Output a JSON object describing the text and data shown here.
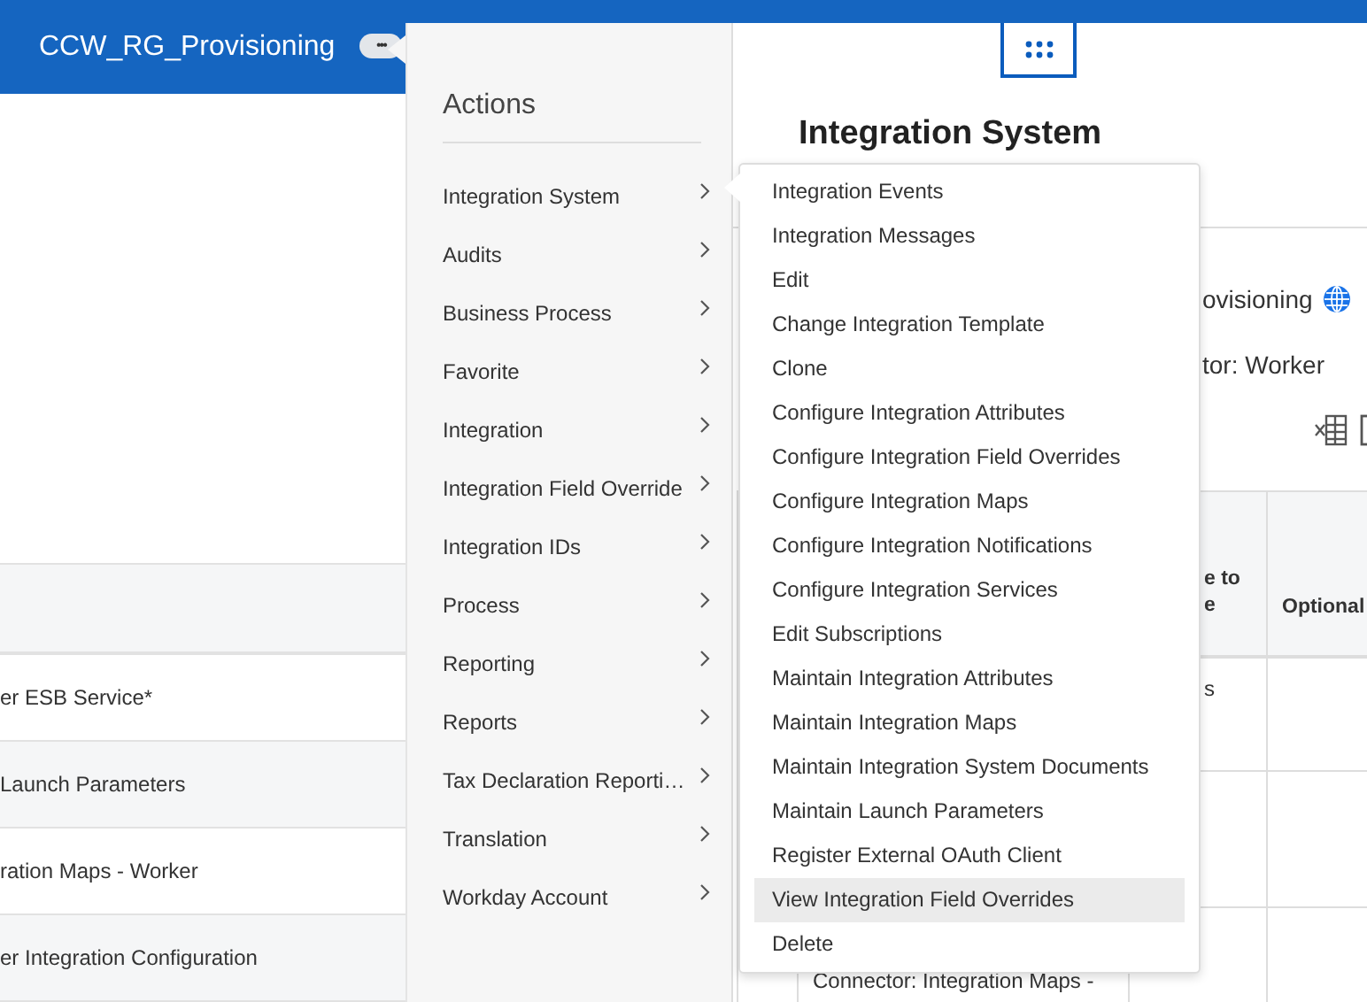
{
  "header": {
    "title": "CCW_RG_Provisioning",
    "more_button": "•••"
  },
  "background_table": {
    "rows": [
      {
        "text": "er ESB Service*"
      },
      {
        "text": "Launch Parameters"
      },
      {
        "text": "ration Maps - Worker"
      },
      {
        "text": "er Integration Configuration"
      }
    ]
  },
  "panel": {
    "title": "Integration System",
    "name_fragment": "ovisioning",
    "type_fragment": "tor: Worker",
    "table": {
      "columns": [
        "e to\ne",
        "Optional"
      ],
      "cells": [
        "s",
        "Connector: Integration Maps -"
      ]
    }
  },
  "actions_menu": {
    "title": "Actions",
    "items": [
      {
        "label": "Integration System"
      },
      {
        "label": "Audits"
      },
      {
        "label": "Business Process"
      },
      {
        "label": "Favorite"
      },
      {
        "label": "Integration"
      },
      {
        "label": "Integration Field Override"
      },
      {
        "label": "Integration IDs"
      },
      {
        "label": "Process"
      },
      {
        "label": "Reporting"
      },
      {
        "label": "Reports"
      },
      {
        "label": "Tax Declaration Reporti…"
      },
      {
        "label": "Translation"
      },
      {
        "label": "Workday Account"
      }
    ]
  },
  "submenu": {
    "items": [
      {
        "label": "Integration Events",
        "selected": false
      },
      {
        "label": "Integration Messages",
        "selected": false
      },
      {
        "label": "Edit",
        "selected": false
      },
      {
        "label": "Change Integration Template",
        "selected": false
      },
      {
        "label": "Clone",
        "selected": false
      },
      {
        "label": "Configure Integration Attributes",
        "selected": false
      },
      {
        "label": "Configure Integration Field Overrides",
        "selected": false
      },
      {
        "label": "Configure Integration Maps",
        "selected": false
      },
      {
        "label": "Configure Integration Notifications",
        "selected": false
      },
      {
        "label": "Configure Integration Services",
        "selected": false
      },
      {
        "label": "Edit Subscriptions",
        "selected": false
      },
      {
        "label": "Maintain Integration Attributes",
        "selected": false
      },
      {
        "label": "Maintain Integration Maps",
        "selected": false
      },
      {
        "label": "Maintain Integration System Documents",
        "selected": false
      },
      {
        "label": "Maintain Launch Parameters",
        "selected": false
      },
      {
        "label": "Register External OAuth Client",
        "selected": false
      },
      {
        "label": "View Integration Field Overrides",
        "selected": true
      },
      {
        "label": "Delete",
        "selected": false
      }
    ]
  }
}
